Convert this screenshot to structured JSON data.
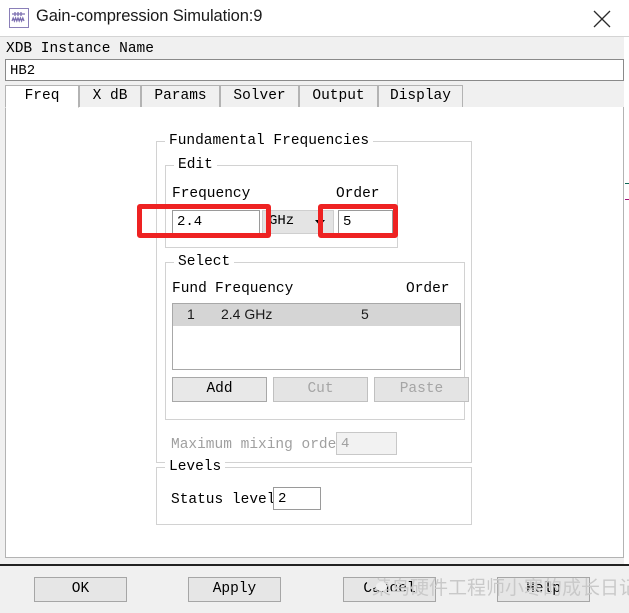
{
  "window": {
    "title": "Gain-compression Simulation:9",
    "icon": "waveform-schematic-icon",
    "close_label": "×"
  },
  "instance": {
    "label": "XDB Instance Name",
    "value": "HB2",
    "placeholder": ""
  },
  "tabs": [
    {
      "label": "Freq",
      "active": true
    },
    {
      "label": "X dB",
      "active": false
    },
    {
      "label": "Params",
      "active": false
    },
    {
      "label": "Solver",
      "active": false
    },
    {
      "label": "Output",
      "active": false
    },
    {
      "label": "Display",
      "active": false
    }
  ],
  "fundamental": {
    "group_title": "Fundamental Frequencies",
    "edit": {
      "group_title": "Edit",
      "frequency_label": "Frequency",
      "frequency_value": "2.4",
      "unit_value": "GHz",
      "order_label": "Order",
      "order_value": "5"
    },
    "select": {
      "group_title": "Select",
      "columns": [
        "Fund",
        "Frequency",
        "Order"
      ],
      "rows": [
        {
          "fund": "1",
          "frequency": "2.4 GHz",
          "order": "5",
          "selected": true
        }
      ],
      "buttons": [
        {
          "label": "Add",
          "enabled": true
        },
        {
          "label": "Cut",
          "enabled": false
        },
        {
          "label": "Paste",
          "enabled": false
        }
      ]
    },
    "max_mixing_order_label": "Maximum mixing order",
    "max_mixing_order_value": "4",
    "max_mixing_order_enabled": false
  },
  "levels": {
    "group_title": "Levels",
    "status_level_label": "Status level",
    "status_level_value": "2"
  },
  "footer": {
    "buttons": [
      {
        "label": "OK"
      },
      {
        "label": "Apply"
      },
      {
        "label": "Cancel"
      },
      {
        "label": "Help"
      }
    ]
  },
  "watermark": {
    "text": "菜鸟硬件工程师小寒的成长日记"
  },
  "colors": {
    "annotation": "#ee2222",
    "dialog_bg": "#f0f0f0",
    "page_bg": "#ffffff",
    "selection": "#d5d5d5",
    "disabled_text": "#a0a0a0"
  }
}
